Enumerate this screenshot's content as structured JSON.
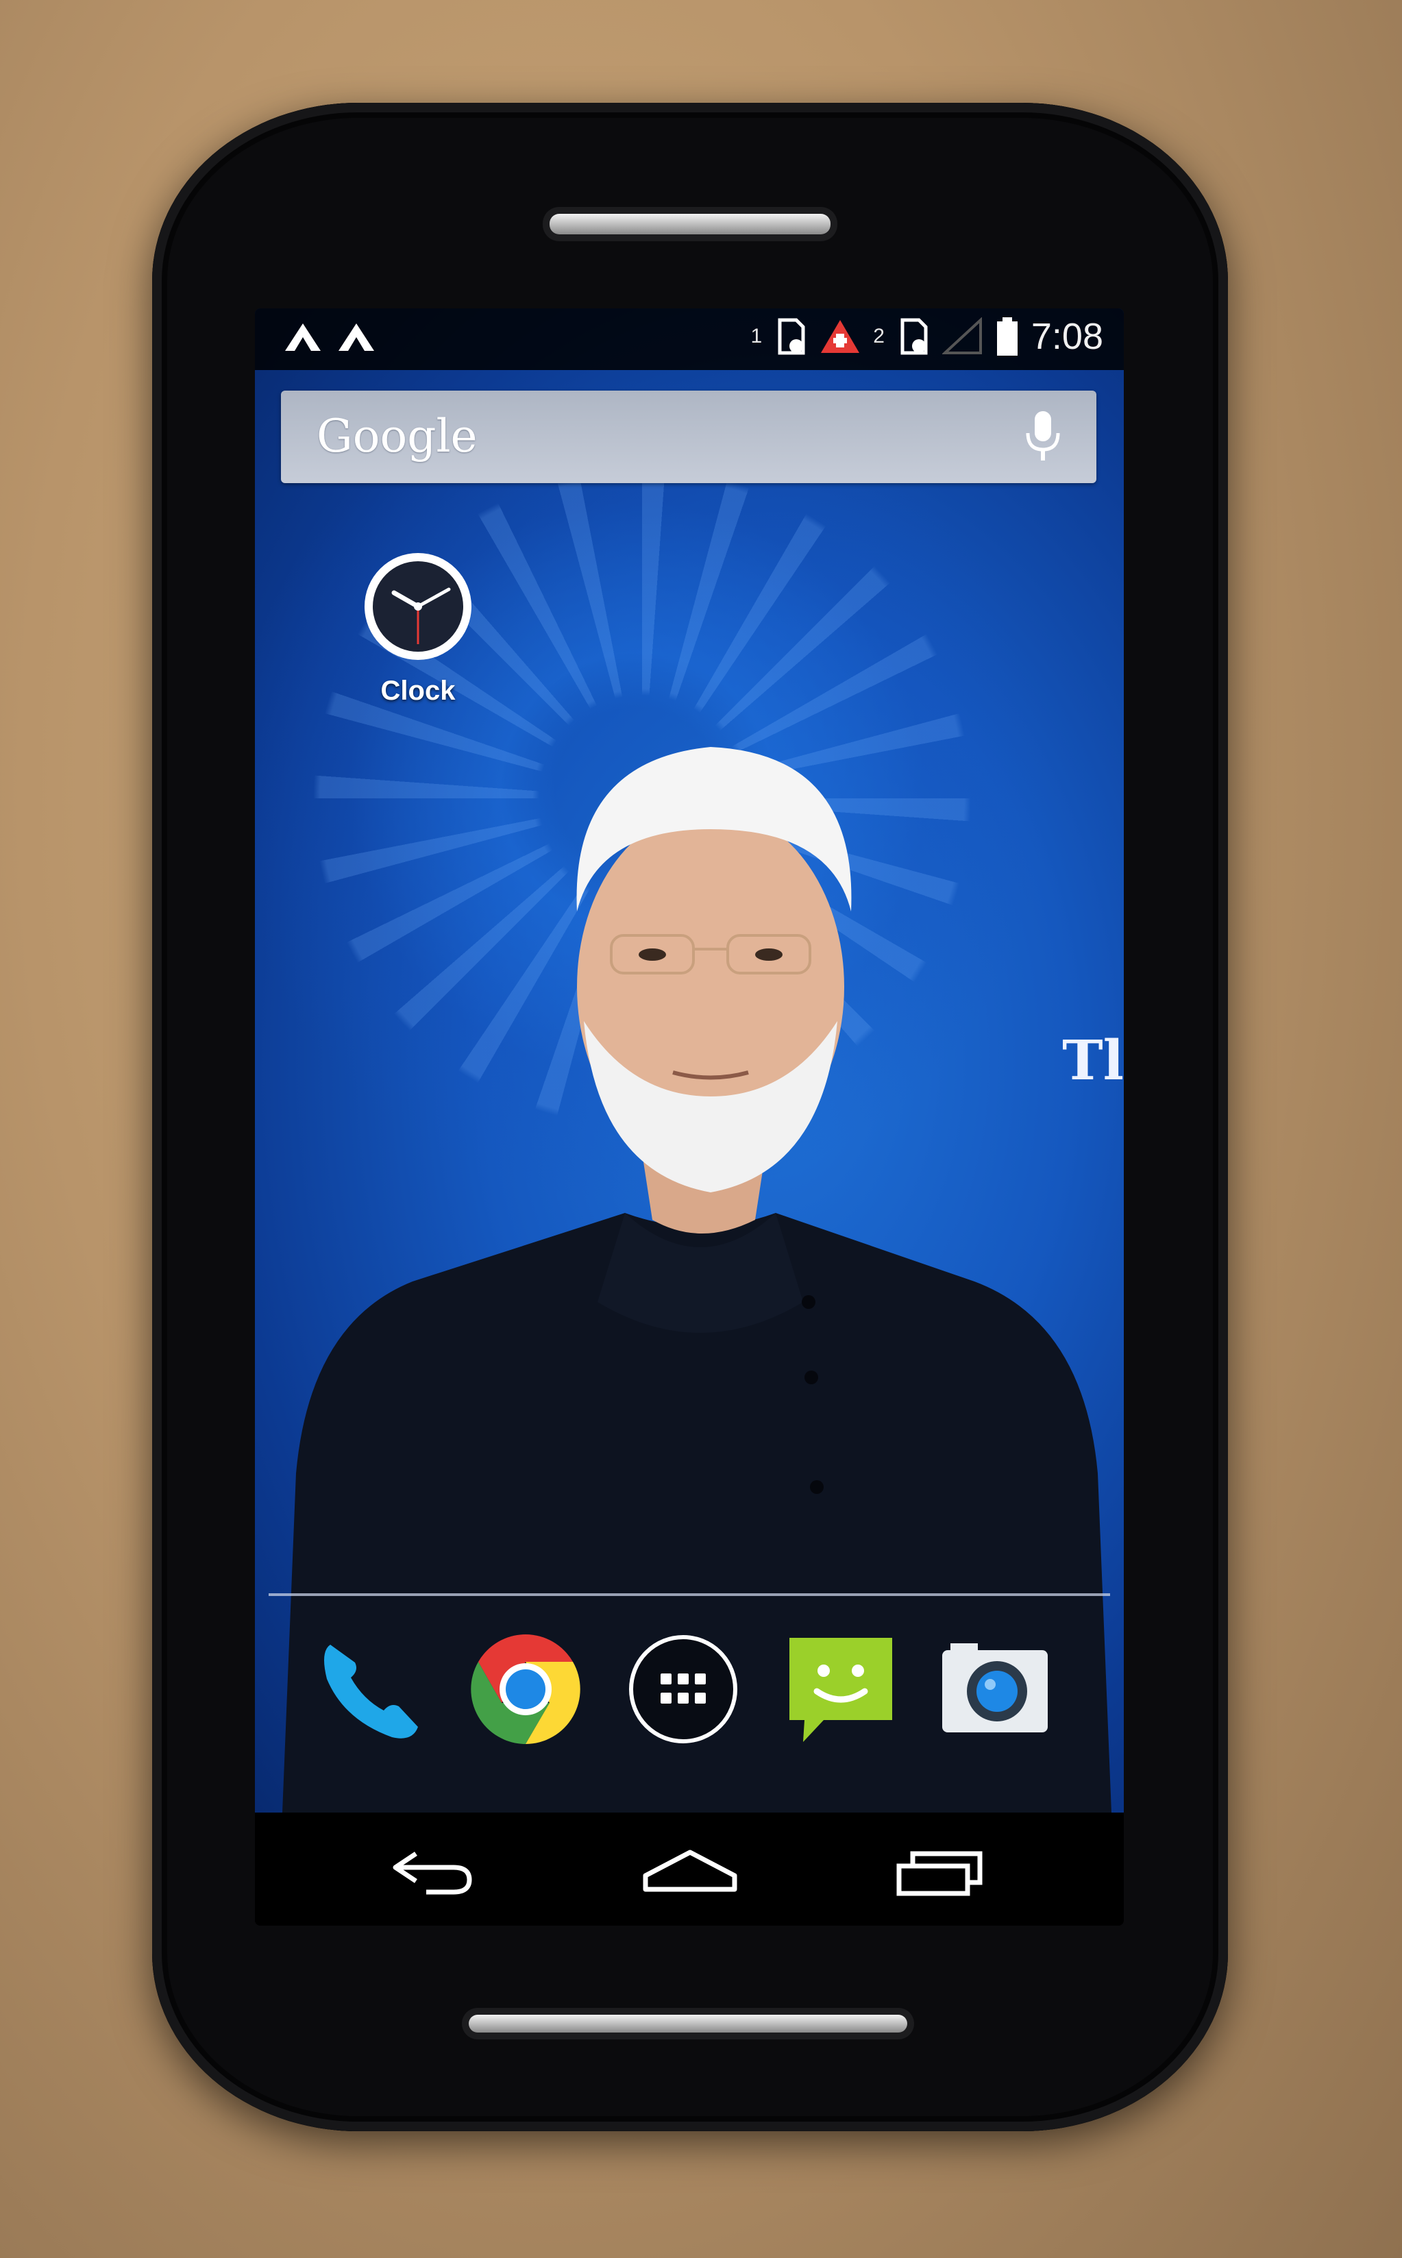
{
  "status_bar": {
    "sim1_label": "1",
    "sim2_label": "2",
    "time": "7:08",
    "left_icons": [
      "notification-app-icon",
      "notification-app-icon"
    ],
    "right_icons": [
      "sim1-icon",
      "alert-icon",
      "sim2-icon",
      "signal-icon",
      "battery-icon"
    ]
  },
  "search": {
    "label": "Google",
    "icon": "mic-icon"
  },
  "home_apps": [
    {
      "label": "Clock",
      "icon": "clock-icon"
    }
  ],
  "wallpaper": {
    "partial_text": "Tl"
  },
  "dock": [
    {
      "name": "phone",
      "icon": "phone-icon"
    },
    {
      "name": "chrome",
      "icon": "chrome-icon"
    },
    {
      "name": "app-drawer",
      "icon": "apps-grid-icon"
    },
    {
      "name": "messaging",
      "icon": "message-icon"
    },
    {
      "name": "camera",
      "icon": "camera-icon"
    }
  ],
  "nav_bar": [
    "back-icon",
    "home-icon",
    "recents-icon"
  ],
  "colors": {
    "wallpaper_blue": "#1558bf",
    "messaging_green": "#9bd02a",
    "alert_red": "#e53935",
    "phone_blue": "#1fa7e8"
  }
}
